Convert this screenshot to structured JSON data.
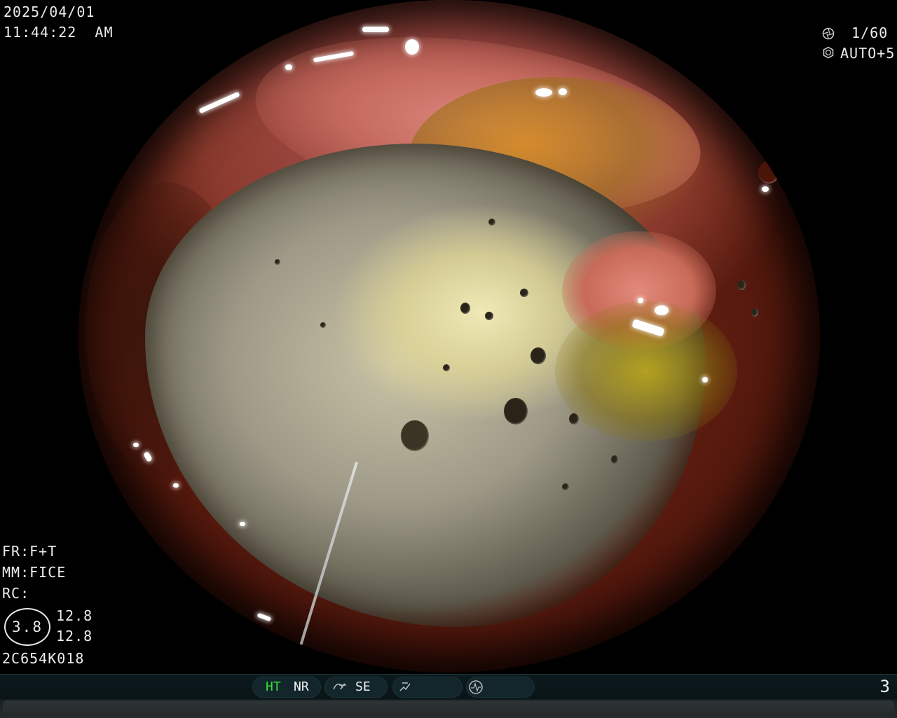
{
  "header": {
    "date": "2025/04/01",
    "time": "11:44:22  AM"
  },
  "exposure": {
    "shutter": "1/60",
    "iris": "AUTO+5",
    "shutter_icon": "shutter-icon",
    "iris_icon": "iris-icon"
  },
  "settings": {
    "fr": "FR:F+T",
    "mm": "MM:FICE",
    "rc": "RC:",
    "zoom": "3.8",
    "value_top": "12.8",
    "value_bottom": "12.8",
    "scope_id": "2C654K018"
  },
  "status_bar": {
    "ht": "HT",
    "nr": "NR",
    "se": "SE",
    "page": "3",
    "ht_color": "#35e035",
    "icons": [
      "structure-enhance-icon",
      "color-enhance-icon",
      "mode-icon"
    ]
  }
}
